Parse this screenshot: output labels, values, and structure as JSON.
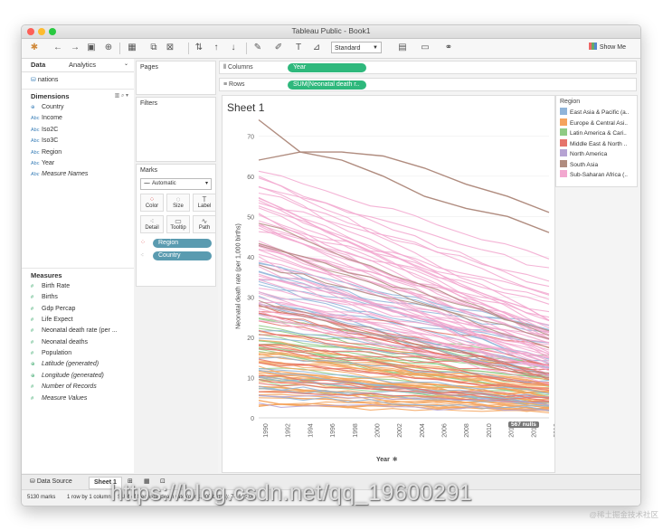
{
  "window": {
    "title": "Tableau Public - Book1"
  },
  "toolbar": {
    "marks_fit": "Standard",
    "show_me": "Show Me"
  },
  "data_pane": {
    "tabs": [
      "Data",
      "Analytics"
    ],
    "source": "nations",
    "dimensions_header": "Dimensions",
    "dimensions": [
      {
        "type": "globe",
        "name": "Country",
        "italic": false
      },
      {
        "type": "Abc",
        "name": "Income",
        "italic": false
      },
      {
        "type": "Abc",
        "name": "Iso2C",
        "italic": false
      },
      {
        "type": "Abc",
        "name": "Iso3C",
        "italic": false
      },
      {
        "type": "Abc",
        "name": "Region",
        "italic": false
      },
      {
        "type": "Abc",
        "name": "Year",
        "italic": false
      },
      {
        "type": "Abc",
        "name": "Measure Names",
        "italic": true
      }
    ],
    "measures_header": "Measures",
    "measures": [
      {
        "type": "#",
        "name": "Birth Rate",
        "italic": false
      },
      {
        "type": "#",
        "name": "Births",
        "italic": false
      },
      {
        "type": "#",
        "name": "Gdp Percap",
        "italic": false
      },
      {
        "type": "#",
        "name": "Life Expect",
        "italic": false
      },
      {
        "type": "#",
        "name": "Neonatal death rate (per ...",
        "italic": false
      },
      {
        "type": "#",
        "name": "Neonatal deaths",
        "italic": false
      },
      {
        "type": "#",
        "name": "Population",
        "italic": false
      },
      {
        "type": "globe",
        "name": "Latitude (generated)",
        "italic": true
      },
      {
        "type": "globe",
        "name": "Longitude (generated)",
        "italic": true
      },
      {
        "type": "#",
        "name": "Number of Records",
        "italic": true
      },
      {
        "type": "#",
        "name": "Measure Values",
        "italic": true
      }
    ]
  },
  "cards": {
    "pages": "Pages",
    "filters": "Filters",
    "marks": "Marks",
    "mark_type": "Automatic",
    "mark_buttons": [
      "Color",
      "Size",
      "Label",
      "Detail",
      "Tooltip",
      "Path"
    ],
    "mark_pills": [
      "Region",
      "Country"
    ]
  },
  "shelves": {
    "columns_label": "Columns",
    "columns_pill": "Year",
    "rows_label": "Rows",
    "rows_pill": "SUM(Neonatal death r.."
  },
  "sheet": {
    "title": "Sheet 1",
    "x_axis_label": "Year",
    "y_axis_label": "Neonatal death rate (per 1,000 births)",
    "nulls": "567 nulls"
  },
  "chart_data": {
    "type": "line",
    "x_ticks": [
      "1990",
      "1992",
      "1994",
      "1996",
      "1998",
      "2000",
      "2002",
      "2004",
      "2006",
      "2008",
      "2010",
      "2012",
      "2014",
      "2016"
    ],
    "y_ticks": [
      "0",
      "10",
      "20",
      "30",
      "40",
      "50",
      "60",
      "70"
    ],
    "xlim": [
      1990,
      2016
    ],
    "ylim": [
      0,
      75
    ],
    "xlabel": "Year",
    "ylabel": "Neonatal death rate (per 1,000 births)",
    "series_note": "one line per country, colored by region",
    "regions": [
      {
        "name": "East Asia & Pacific (a..",
        "color": "#8fb4d9"
      },
      {
        "name": "Europe & Central Asi..",
        "color": "#f5a35c"
      },
      {
        "name": "Latin America & Cari..",
        "color": "#8fcb84"
      },
      {
        "name": "Middle East & North ..",
        "color": "#e5736b"
      },
      {
        "name": "North America",
        "color": "#b6a3d3"
      },
      {
        "name": "South Asia",
        "color": "#b08c7f"
      },
      {
        "name": "Sub-Saharan Africa (..",
        "color": "#f2a7cf"
      }
    ],
    "highlight_series": [
      {
        "name": "South Asia top",
        "values": [
          74,
          66,
          64,
          60,
          55,
          52,
          50,
          46
        ]
      },
      {
        "name": "South Asia second",
        "values": [
          64,
          66,
          66,
          65,
          62,
          58,
          55,
          51
        ]
      }
    ]
  },
  "legend": {
    "title": "Region"
  },
  "tabs": {
    "data_source": "Data Source",
    "sheet": "Sheet 1"
  },
  "status": {
    "marks": "5130 marks",
    "dims": "1 row by 1 column",
    "sum": "SUM of Neonatal death rate (per 1,000 births): 74,645.00"
  },
  "watermark": "https://blog.csdn.net/qq_19600291",
  "watermark2": "@稀土掘金技术社区"
}
